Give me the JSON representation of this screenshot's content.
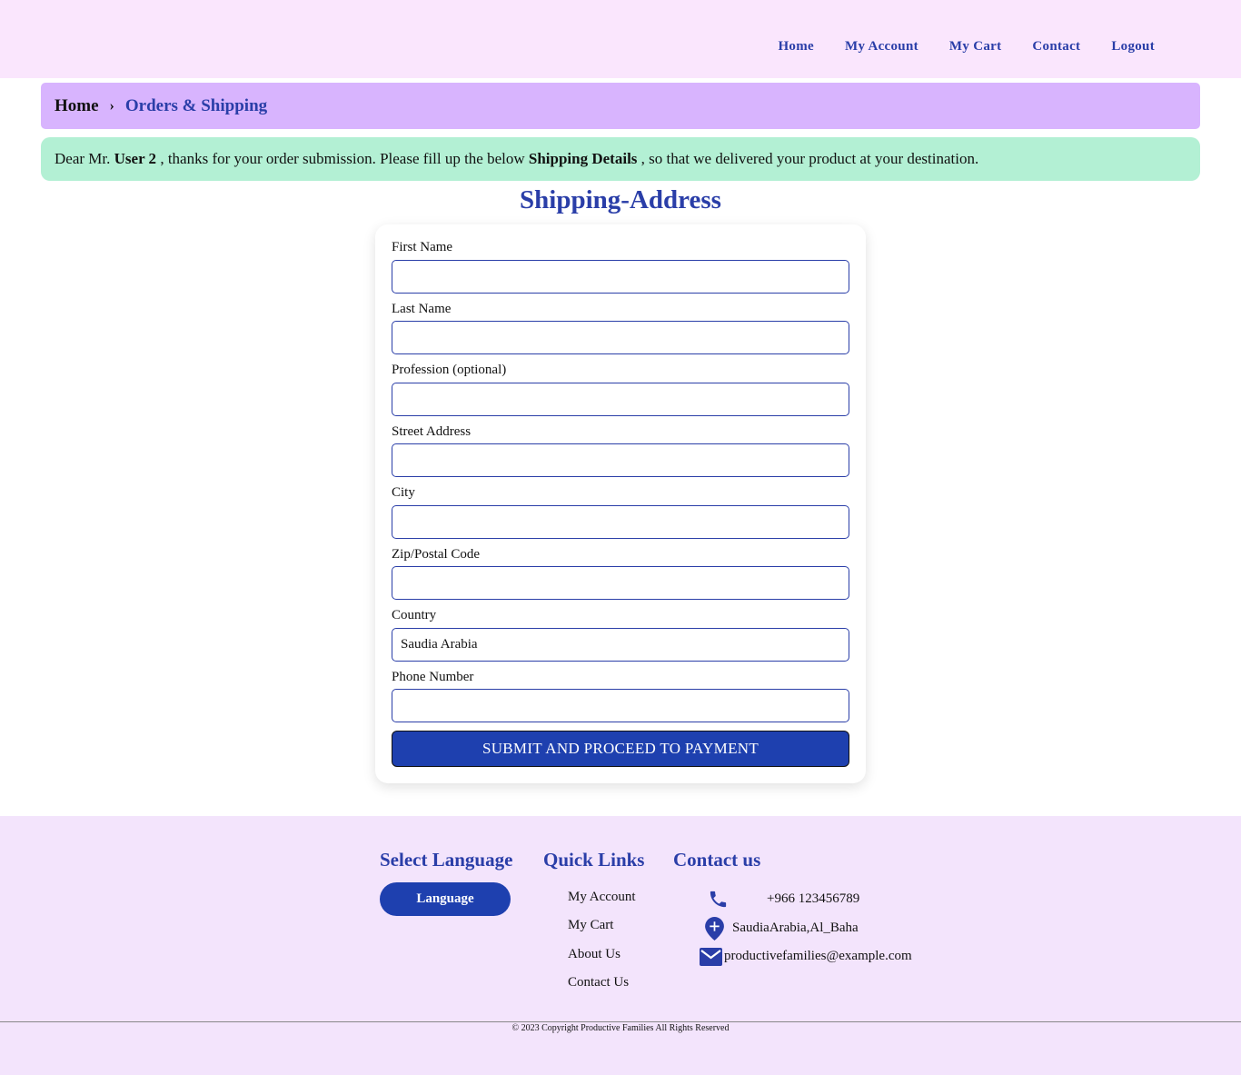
{
  "nav": {
    "items": [
      {
        "label": "Home"
      },
      {
        "label": "My Account"
      },
      {
        "label": "My Cart"
      },
      {
        "label": "Contact"
      },
      {
        "label": "Logout"
      }
    ]
  },
  "breadcrumb": {
    "home": "Home",
    "separator": "›",
    "current": "Orders & Shipping"
  },
  "alert": {
    "prefix": "Dear Mr.",
    "user": "User 2",
    "middle": ", thanks for your order submission. Please fill up the below",
    "emphasis": "Shipping Details",
    "suffix": ", so that we delivered your product at your destination."
  },
  "page_title": "Shipping-Address",
  "form": {
    "fields": [
      {
        "label": "First Name",
        "value": ""
      },
      {
        "label": "Last Name",
        "value": ""
      },
      {
        "label": "Profession (optional)",
        "value": ""
      },
      {
        "label": "Street Address",
        "value": ""
      },
      {
        "label": "City",
        "value": ""
      },
      {
        "label": "Zip/Postal Code",
        "value": ""
      },
      {
        "label": "Country",
        "value": "Saudia Arabia"
      },
      {
        "label": "Phone Number",
        "value": ""
      }
    ],
    "submit_label": "SUBMIT AND PROCEED TO PAYMENT"
  },
  "footer": {
    "language": {
      "heading": "Select Language",
      "button_label": "Language"
    },
    "quick_links": {
      "heading": "Quick Links",
      "items": [
        "My Account",
        "My Cart",
        "About Us",
        "Contact Us"
      ]
    },
    "contact": {
      "heading": "Contact us",
      "phone": "+966 123456789",
      "location": "SaudiaArabia,Al_Baha",
      "email": "productivefamilies@example.com"
    },
    "copyright": "© 2023 Copyright Productive Families All Rights Reserved"
  },
  "colors": {
    "accent": "#2a3ea8",
    "button": "#1e40af",
    "header_bg": "#fae6fd",
    "breadcrumb_bg": "#d8b4fe",
    "alert_bg": "#b3f0d4",
    "footer_bg": "#f3e4fc"
  }
}
